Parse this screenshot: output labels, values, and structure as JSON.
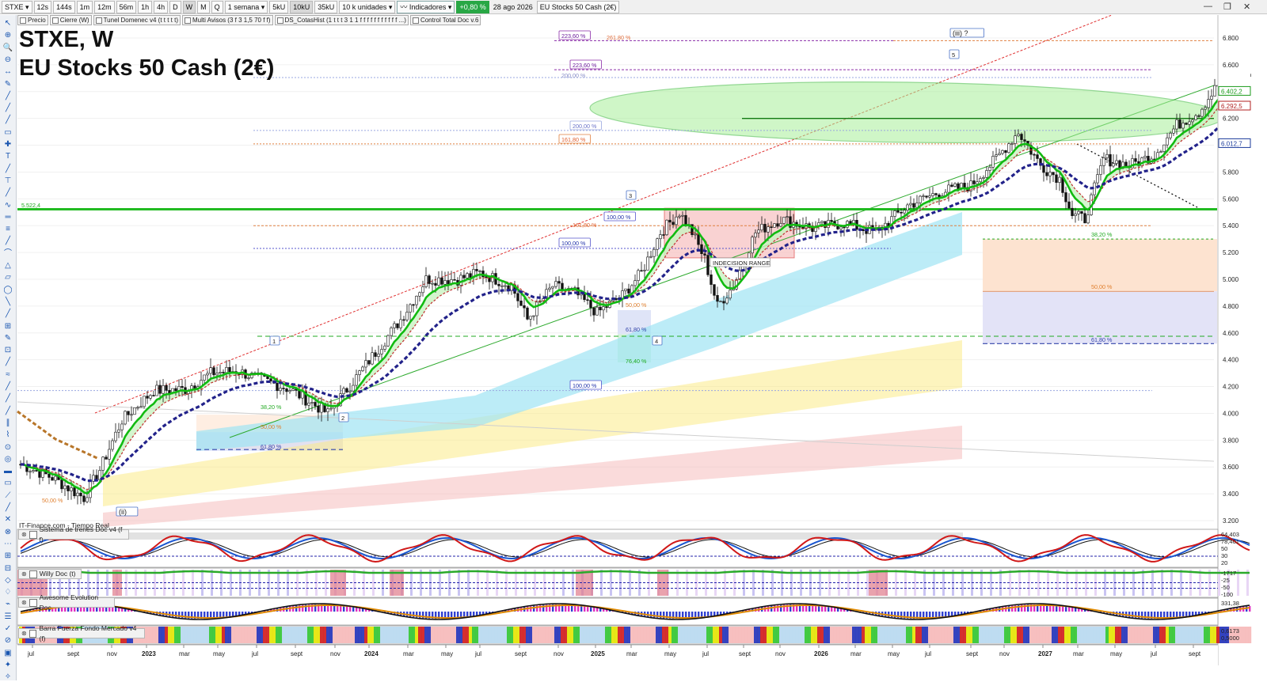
{
  "toolbar": {
    "symbol": "STXE",
    "timeframes": [
      "12s",
      "144s",
      "1m",
      "12m",
      "56m",
      "1h",
      "4h",
      "D",
      "W",
      "M",
      "Q"
    ],
    "active_timeframe": "W",
    "period": "1 semana",
    "units": [
      "5kU",
      "10kU",
      "35kU"
    ],
    "active_unit": "10kU",
    "unit_select": "10 k unidades",
    "indicators_label": "Indicadores",
    "change": "+0,80 %",
    "date": "28 ago 2026",
    "instrument": "EU Stocks 50 Cash (2€)"
  },
  "indicator_tabs": [
    "Precio",
    "Cierre (W)",
    "Tunel Domenec v4 (t t t t t)",
    "Multi Avisos (3 f 3 1,5 70 f f)",
    "DS_CotasHist (1 t t t 3 1 1 f f f f f f f f f f f ...)",
    "Control Total Doc v.6"
  ],
  "header": {
    "line1": "STXE, W",
    "line2": "EU Stocks 50 Cash (2€)"
  },
  "source_label": "IT-Finance.com - Tiempo Real",
  "colors": {
    "up_candle": "#ffffff",
    "down_candle": "#111111",
    "ema_fast": "#11bb11",
    "ema_slow": "#22228a",
    "support": "#22bb22",
    "bull_fill": "#c9f2c2"
  },
  "price_axis": {
    "ticks": [
      "6.800",
      "6.600",
      "6.400",
      "6.200",
      "6.000",
      "5.800",
      "5.600",
      "5.400",
      "5.200",
      "5.000",
      "4.800",
      "4.600",
      "4.400",
      "4.200",
      "4.000",
      "3.800",
      "3.600",
      "3.400",
      "3.200"
    ],
    "markers": [
      {
        "text": "6.402,2",
        "price": 6402.2,
        "color": "#1a9a1a"
      },
      {
        "text": "6.292,5",
        "price": 6292.5,
        "color": "#b02020"
      },
      {
        "text": "6.012,7",
        "price": 6012.7,
        "color": "#1a3a9a"
      }
    ]
  },
  "time_axis": [
    "jul",
    "sept",
    "nov",
    "2023",
    "mar",
    "may",
    "jul",
    "sept",
    "nov",
    "2024",
    "mar",
    "may",
    "jul",
    "sept",
    "nov",
    "2025",
    "mar",
    "may",
    "jul",
    "sept",
    "nov",
    "2026",
    "mar",
    "may",
    "jul",
    "sept",
    "nov",
    "2027",
    "mar",
    "may",
    "jul",
    "sept"
  ],
  "level_labels": {
    "support": "5.522,4",
    "wave_1": "1",
    "wave_2": "2",
    "wave_3": "3",
    "wave_4": "4",
    "wave_5": "5",
    "wave_ii": "(ii)",
    "wave_iii": "(iii) ?",
    "range": "INDECISION RANGE",
    "fib_223a": "223,60 %",
    "fib_261": "261,80 %",
    "fib_223b": "223,60 %",
    "fib_200a": "200,00 %",
    "fib_200b": "200,00 %",
    "fib_161": "161,80 %",
    "fib_161b": "161,80 %",
    "fib_100a": "100,00 %",
    "fib_100b": "100,00 %",
    "fib_100c": "100,00 %",
    "fib_50a": "50,00 %",
    "fib_618a": "61,80 %",
    "fib_764": "76,40 %",
    "fib_382a": "38,20 %",
    "fib_50b": "50,00 %",
    "fib_618b": "61,80 %",
    "fib_50c": "50,00 %",
    "fib_382r": "38,20 %",
    "fib_50r": "50,00 %",
    "fib_618r": "61,80 %"
  },
  "panels": [
    {
      "name": "Sistema de trenes Doc v4 (f f)",
      "values": [
        "64,403",
        "78,401",
        "50",
        "30",
        "20"
      ]
    },
    {
      "name": "Willy Doc (t)",
      "values": [
        "-1717",
        "-25",
        "-50",
        "-100"
      ]
    },
    {
      "name": "Awesome Evolution Doc",
      "values": [
        "331,38"
      ]
    },
    {
      "name": "Barra Fuerza Fondo Mercado v4 (f)",
      "values": [
        "0,6173",
        "0,5000"
      ]
    }
  ]
}
